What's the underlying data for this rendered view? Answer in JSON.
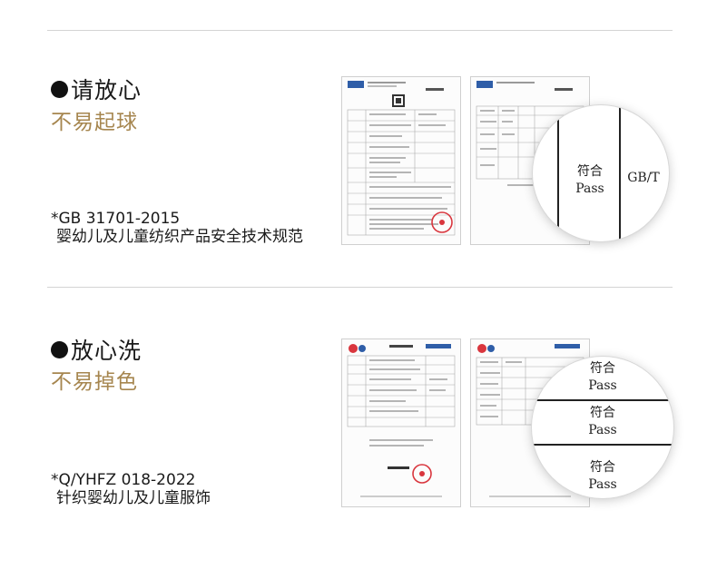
{
  "sections": [
    {
      "heading": "请放心",
      "subheading": "不易起球",
      "standard_code": "*GB 31701-2015",
      "standard_name": "婴幼儿及儿童纺织产品安全技术规范",
      "magnifier": {
        "cell_top": "符合",
        "cell_bottom": "Pass",
        "cell_right": "GB/T"
      }
    },
    {
      "heading": "放心洗",
      "subheading": "不易掉色",
      "standard_code": "*Q/YHFZ 018-2022",
      "standard_name": "针织婴幼儿及儿童服饰",
      "magnifier": {
        "row1_top": "符合",
        "row1_bottom": "Pass",
        "row2_top": "符合",
        "row2_bottom": "Pass",
        "row3_top": "符合",
        "row3_bottom": "Pass"
      }
    }
  ],
  "colors": {
    "accent": "#a6864f",
    "divider": "#d4d4d4",
    "stamp": "#d9363e"
  }
}
